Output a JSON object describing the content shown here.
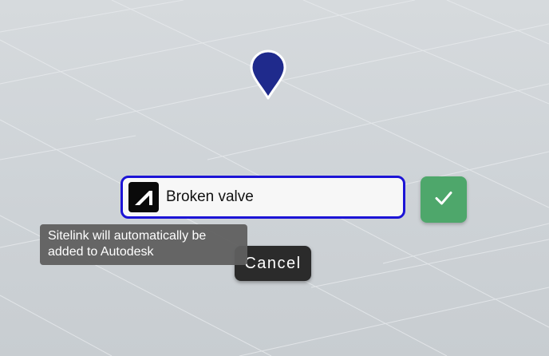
{
  "map_pin": {
    "icon": "map-pin-icon",
    "color": "#1f2a8c"
  },
  "label_input": {
    "value": "Broken valve",
    "border_color": "#1c14d6",
    "logo_icon": "autodesk-logo-icon"
  },
  "confirm_button": {
    "icon": "check-icon",
    "color": "#4ea76b"
  },
  "cancel_button": {
    "label": "Cancel"
  },
  "tooltip": {
    "line1": "Sitelink will automatically be",
    "line2": "added to Autodesk"
  }
}
